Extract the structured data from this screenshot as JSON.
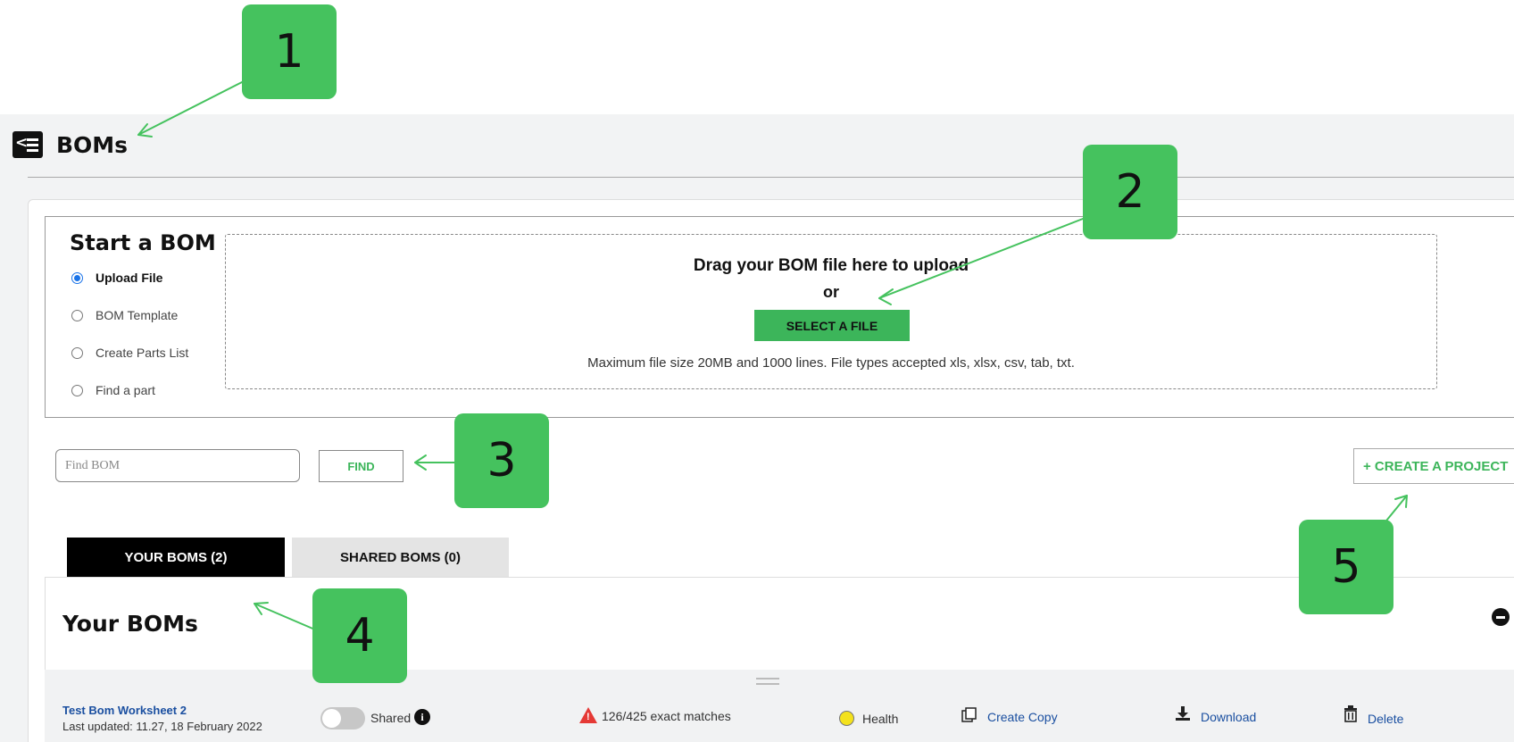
{
  "header": {
    "title": "BOMs"
  },
  "start": {
    "title": "Start a BOM",
    "options": [
      {
        "label": "Upload File",
        "selected": true
      },
      {
        "label": "BOM Template",
        "selected": false
      },
      {
        "label": "Create Parts List",
        "selected": false
      },
      {
        "label": "Find a part",
        "selected": false
      }
    ]
  },
  "dropzone": {
    "title": "Drag your BOM file here to upload",
    "or": "or",
    "button": "SELECT A FILE",
    "note": "Maximum file size 20MB and 1000 lines. File types accepted xls, xlsx, csv, tab, txt."
  },
  "search": {
    "placeholder": "Find BOM",
    "value": "",
    "button": "FIND"
  },
  "create_project": "+ CREATE A PROJECT",
  "tabs": [
    {
      "label": "YOUR BOMS (2)",
      "active": true
    },
    {
      "label": "SHARED BOMS (0)",
      "active": false
    }
  ],
  "panel": {
    "title": "Your BOMs"
  },
  "boms": [
    {
      "name": "Test Bom Worksheet 2",
      "updated": "Last updated: 11.27, 18 February 2022",
      "shared_label": "Shared",
      "shared": false,
      "matches": "126/425 exact matches",
      "health_label": "Health",
      "health_color": "#f4e21c",
      "copy_label": "Create Copy",
      "download_label": "Download",
      "delete_label": "Delete"
    }
  ],
  "annotations": [
    {
      "number": "1",
      "color": "#45c25e"
    },
    {
      "number": "2",
      "color": "#45c25e"
    },
    {
      "number": "3",
      "color": "#45c25e"
    },
    {
      "number": "4",
      "color": "#45c25e"
    },
    {
      "number": "5",
      "color": "#45c25e"
    }
  ],
  "colors": {
    "accent": "#3cb55a",
    "link": "#1a4fa0",
    "warning": "#e53935"
  }
}
